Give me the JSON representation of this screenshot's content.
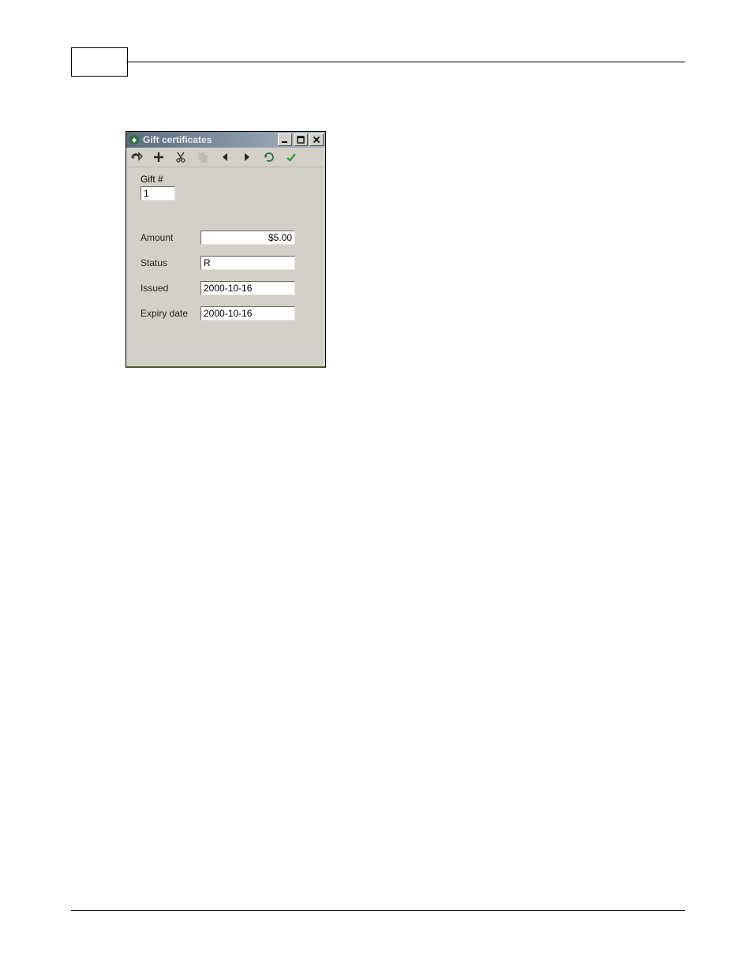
{
  "dialog": {
    "title": "Gift certificates",
    "toolbar": {
      "icons": [
        "redo",
        "add",
        "cut",
        "copy",
        "prev",
        "next",
        "refresh",
        "confirm"
      ]
    },
    "fields": {
      "gift_label": "Gift #",
      "gift_value": "1",
      "amount_label": "Amount",
      "amount_value": "$5.00",
      "status_label": "Status",
      "status_value": "R",
      "issued_label": "Issued",
      "issued_value": "2000-10-16",
      "expiry_label": "Expiry date",
      "expiry_value": "2000-10-16"
    }
  }
}
